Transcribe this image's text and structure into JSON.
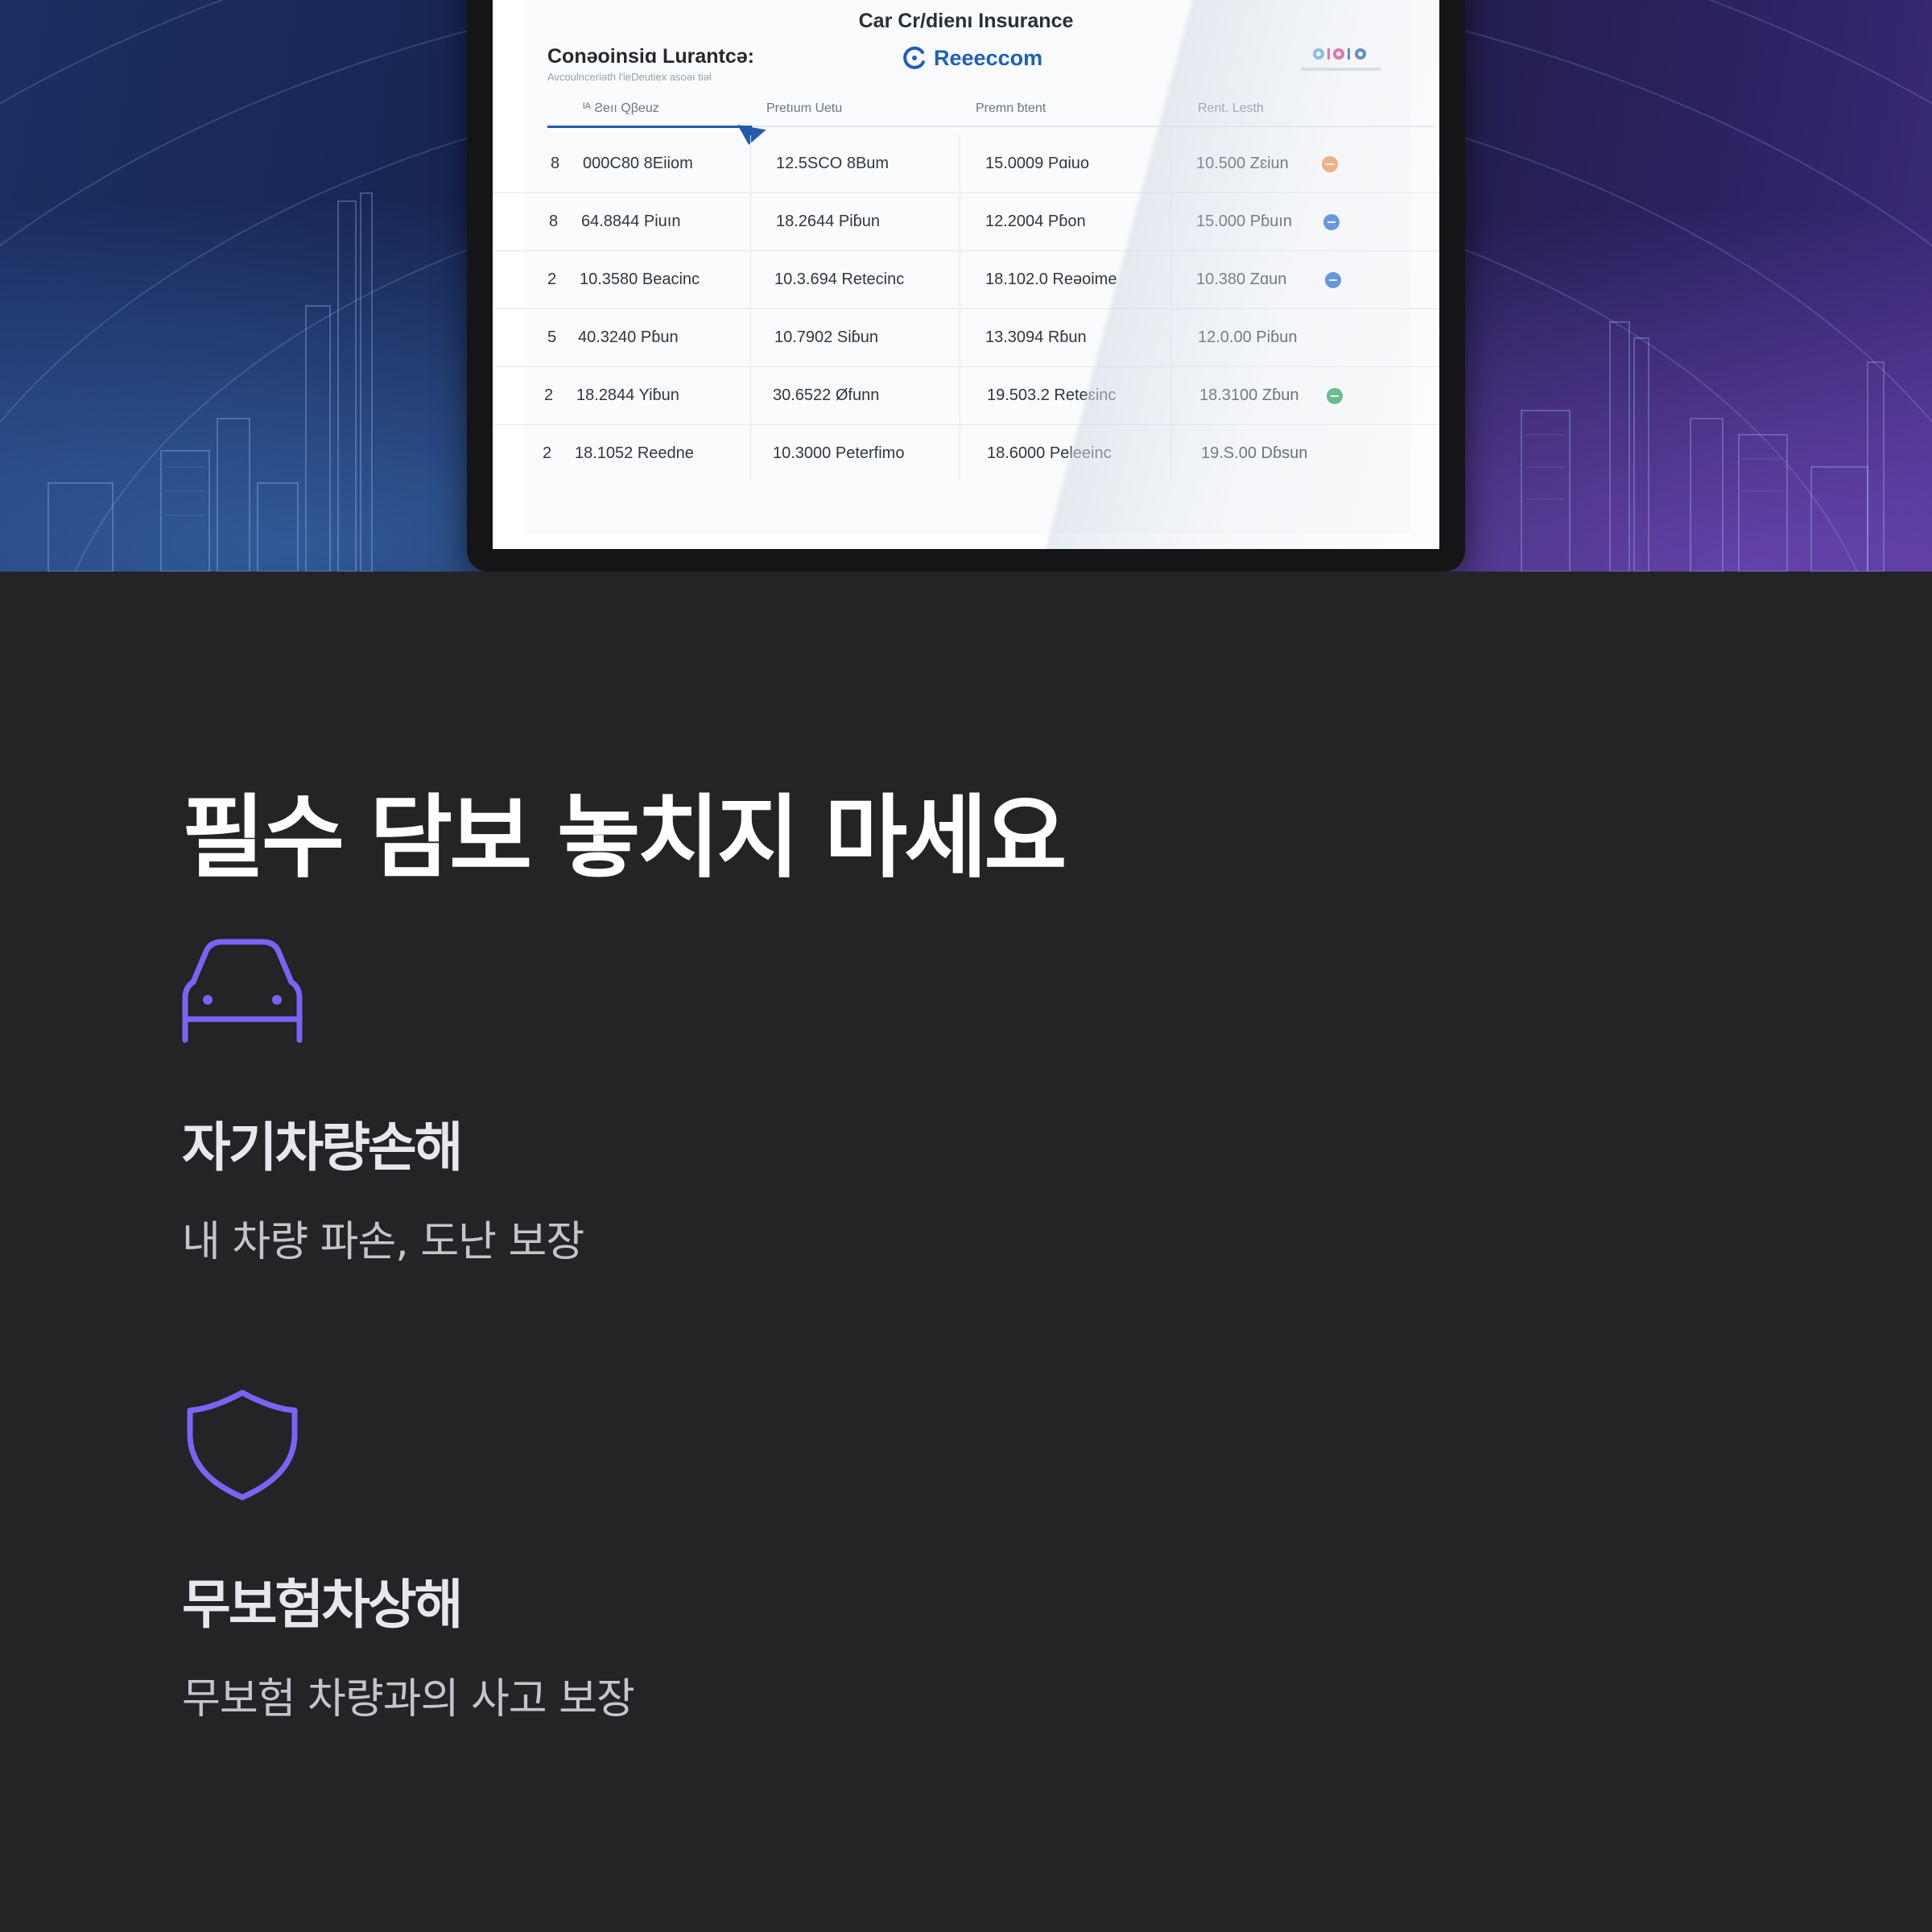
{
  "colors": {
    "page_background": "#242325",
    "accent": "#7b63f5",
    "title": "#ffffff",
    "feature_title": "#e9e7ee",
    "feature_text": "#c6c4cb",
    "table_accent": "#2559ad"
  },
  "hero": {
    "screen": {
      "title": "Car Cr/dienı Insurance",
      "company_name": "Conəoinsiɑ Lurantcə:",
      "company_subtitle": "Avcoulnceriəth l'ieDeutiex asoəı tiəl",
      "brand_icon": "refresh-c-icon",
      "brand_name": "Reeeccom",
      "table": {
        "headers": [
          "ᴵᴬ Ƨeıı Qβeuz",
          "Pretıum Uetu",
          "Premn ƀtent",
          "Rent. Lesth"
        ],
        "rows": [
          {
            "num": "8",
            "c1": "000C80 8Eiiom",
            "c2": "12.5SCO 8Bum",
            "c3": "15.0009 Pɑiuo",
            "c4": "10.500 Zɛiun",
            "status": "orange"
          },
          {
            "num": "8",
            "c1": "64.8844 Piuın",
            "c2": "18.2644 Piɓun",
            "c3": "12.2004 Pɓon",
            "c4": "15.000 Pɓuın",
            "status": "blue"
          },
          {
            "num": "2",
            "c1": "10.3580 Beacinc",
            "c2": "10.3.694 Retecinc",
            "c3": "18.102.0 Reəoime",
            "c4": "10.380 Zɑun",
            "status": "blue"
          },
          {
            "num": "5",
            "c1": "40.3240 Pɓun",
            "c2": "10.7902 Siɓun",
            "c3": "13.3094 Rɓun",
            "c4": "12.0.00 Piɓun",
            "status": "none"
          },
          {
            "num": "2",
            "c1": "18.2844 Yiɓun",
            "c2": "30.6522 Øfunn",
            "c3": "19.503.2 Reteɛinc",
            "c4": "18.3100 Zɓun",
            "status": "green"
          },
          {
            "num": "2",
            "c1": "18.1052 Reedne",
            "c2": "10.3000 Peterfimo",
            "c3": "18.6000 Peleeinc",
            "c4": "19.S.00 Dɓsun",
            "status": "none"
          }
        ]
      }
    }
  },
  "main": {
    "title": "필수 담보 놓치지 마세요",
    "features": [
      {
        "icon": "car-icon",
        "title": "자기차량손해",
        "description": "내 차량 파손, 도난 보장"
      },
      {
        "icon": "shield-icon",
        "title": "무보험차상해",
        "description": "무보험 차량과의 사고 보장"
      }
    ]
  }
}
